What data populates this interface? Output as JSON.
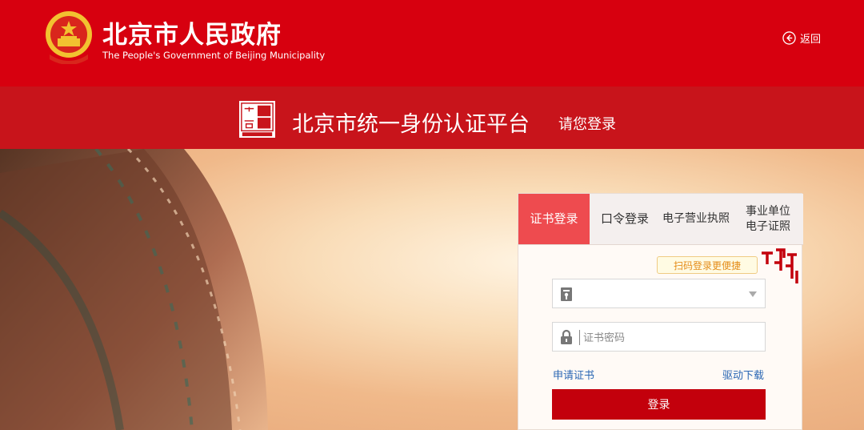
{
  "header": {
    "title_cn": "北京市人民政府",
    "title_en": "The People's Government of Beijing Municipality",
    "back_label": "返回",
    "brand_color": "#d7000f"
  },
  "band": {
    "seal_icon": "capital-seal-icon",
    "platform_title": "北京市统一身份认证平台",
    "please_login": "请您登录"
  },
  "login": {
    "tabs": [
      {
        "label": "证书登录",
        "active": true
      },
      {
        "label": "口令登录",
        "active": false
      },
      {
        "label": "电子营业执照",
        "active": false
      },
      {
        "label_line1": "事业单位",
        "label_line2": "电子证照",
        "active": false
      }
    ],
    "qr_tip": "扫码登录更便捷",
    "certificate_select": {
      "value": ""
    },
    "password": {
      "placeholder": "证书密码",
      "value": ""
    },
    "apply_link": "申请证书",
    "driver_link": "驱动下载",
    "submit_label": "登录",
    "accent_color": "#c3000c",
    "tab_active_color": "#ee4b4f"
  }
}
